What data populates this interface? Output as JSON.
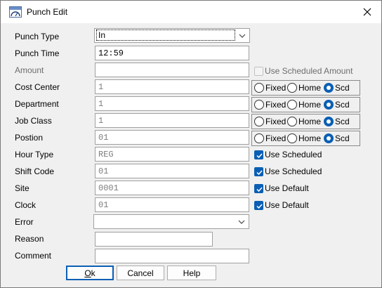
{
  "window": {
    "title": "Punch Edit",
    "icon": "clock-app-icon",
    "close": "close-icon"
  },
  "labels": {
    "punch_type": "Punch Type",
    "punch_time": "Punch Time",
    "amount": "Amount",
    "cost_center": "Cost Center",
    "department": "Department",
    "job_class": "Job Class",
    "position": "Postion",
    "hour_type": "Hour Type",
    "shift_code": "Shift Code",
    "site": "Site",
    "clock": "Clock",
    "error": "Error",
    "reason": "Reason",
    "comment": "Comment"
  },
  "values": {
    "punch_type": "In",
    "punch_time": "12:59",
    "amount": "",
    "cost_center": "1",
    "department": "1",
    "job_class": "1",
    "position": "01",
    "hour_type": "REG",
    "shift_code": "01",
    "site": "0001",
    "clock": "01",
    "error": "",
    "reason": "",
    "comment": ""
  },
  "checkboxes": {
    "amount": {
      "label": "Use Scheduled Amount",
      "checked": false
    },
    "hour_type": {
      "label": "Use Scheduled",
      "checked": true
    },
    "shift_code": {
      "label": "Use Scheduled",
      "checked": true
    },
    "site": {
      "label": "Use Default",
      "checked": true
    },
    "clock": {
      "label": "Use Default",
      "checked": true
    }
  },
  "radio_labels": {
    "fixed": "Fixed",
    "home": "Home",
    "scd": "Scd"
  },
  "radio_selected": {
    "cost_center": "Scd",
    "department": "Scd",
    "job_class": "Scd",
    "position": "Scd"
  },
  "buttons": {
    "ok_underlined": "O",
    "ok_rest": "k",
    "cancel": "Cancel",
    "help": "Help"
  },
  "colors": {
    "accent": "#0a5fb4",
    "window_bg": "#f0f0f0"
  }
}
